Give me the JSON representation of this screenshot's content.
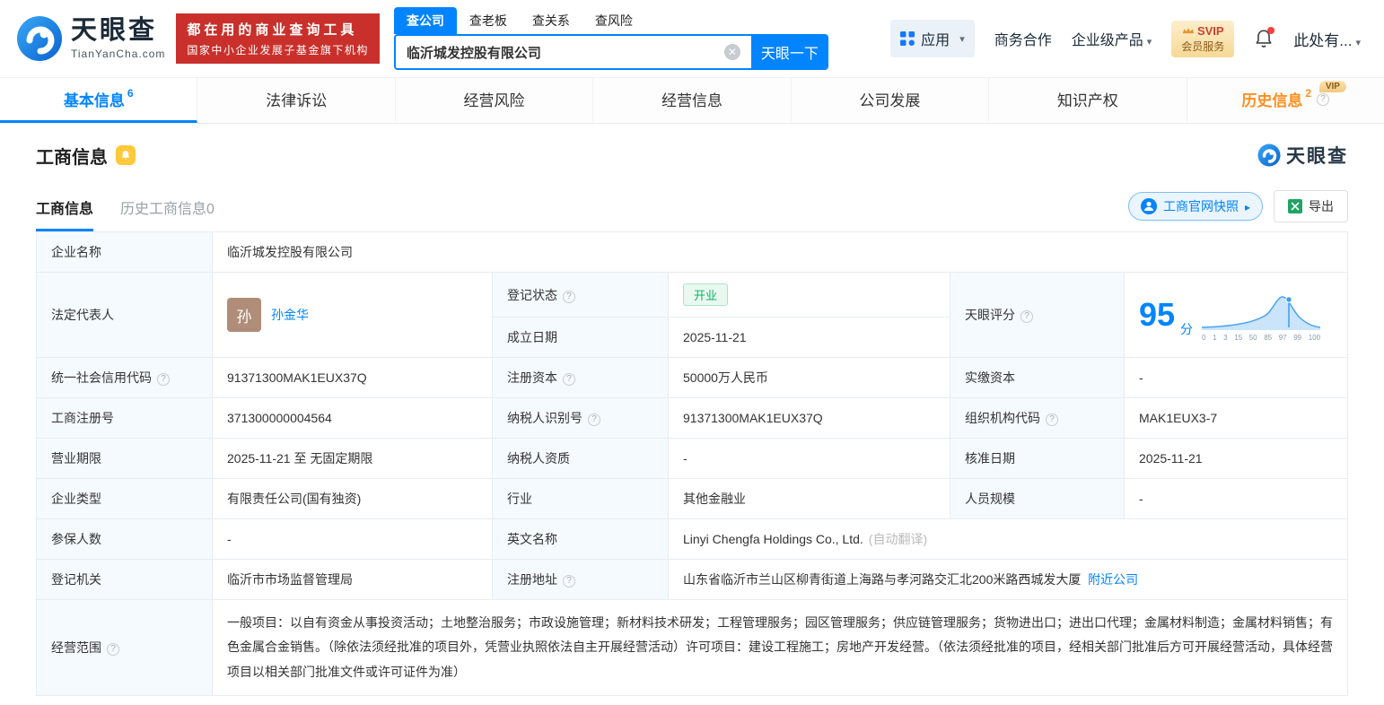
{
  "colors": {
    "accent": "#0084ff",
    "banner_red": "#c9302b",
    "vip_orange": "#ff8f1f",
    "status_green": "#10b267",
    "score_blue": "#0084ff"
  },
  "brand": {
    "name": "天眼查",
    "domain": "TianYanCha.com"
  },
  "banner": {
    "line1": "都在用的商业查询工具",
    "line2": "国家中小企业发展子基金旗下机构"
  },
  "search": {
    "tabs": [
      {
        "label": "查公司"
      },
      {
        "label": "查老板"
      },
      {
        "label": "查关系"
      },
      {
        "label": "查风险"
      }
    ],
    "value": "临沂城发控股有限公司",
    "button": "天眼一下"
  },
  "header_right": {
    "apps": "应用",
    "cooperation": "商务合作",
    "enterprise": "企业级产品",
    "svip_top": "SVIP",
    "svip_bottom": "会员服务",
    "account": "此处有..."
  },
  "nav": [
    {
      "label": "基本信息",
      "count": "6"
    },
    {
      "label": "法律诉讼"
    },
    {
      "label": "经营风险"
    },
    {
      "label": "经营信息"
    },
    {
      "label": "公司发展"
    },
    {
      "label": "知识产权"
    },
    {
      "label": "历史信息",
      "count": "2",
      "vip": "VIP"
    }
  ],
  "section": {
    "title": "工商信息",
    "subtab_active": "工商信息",
    "subtab_history": "历史工商信息0",
    "snapshot": "工商官网快照",
    "export": "导出",
    "watermark": "天眼查"
  },
  "fields": {
    "company_name": {
      "label": "企业名称",
      "value": "临沂城发控股有限公司"
    },
    "legal_rep": {
      "label": "法定代表人",
      "value": "孙金华",
      "avatar": "孙"
    },
    "reg_status": {
      "label": "登记状态",
      "value": "开业"
    },
    "establish_date": {
      "label": "成立日期",
      "value": "2025-11-21"
    },
    "score": {
      "label": "天眼评分",
      "value": "95",
      "unit": "分",
      "ticks": [
        "0",
        "1",
        "3",
        "15",
        "50",
        "85",
        "97",
        "99",
        "100"
      ]
    },
    "credit_code": {
      "label": "统一社会信用代码",
      "value": "91371300MAK1EUX37Q"
    },
    "reg_capital": {
      "label": "注册资本",
      "value": "50000万人民币"
    },
    "paid_capital": {
      "label": "实缴资本",
      "value": "-"
    },
    "reg_number": {
      "label": "工商注册号",
      "value": "371300000004564"
    },
    "taxpayer_id": {
      "label": "纳税人识别号",
      "value": "91371300MAK1EUX37Q"
    },
    "org_code": {
      "label": "组织机构代码",
      "value": "MAK1EUX3-7"
    },
    "business_term": {
      "label": "营业期限",
      "value": "2025-11-21 至 无固定期限"
    },
    "taxpayer_qualification": {
      "label": "纳税人资质",
      "value": "-"
    },
    "approval_date": {
      "label": "核准日期",
      "value": "2025-11-21"
    },
    "company_type": {
      "label": "企业类型",
      "value": "有限责任公司(国有独资)"
    },
    "industry": {
      "label": "行业",
      "value": "其他金融业"
    },
    "staff_size": {
      "label": "人员规模",
      "value": "-"
    },
    "insured_count": {
      "label": "参保人数",
      "value": "-"
    },
    "english_name": {
      "label": "英文名称",
      "value": "Linyi Chengfa Holdings Co., Ltd.",
      "note": "(自动翻译)"
    },
    "reg_authority": {
      "label": "登记机关",
      "value": "临沂市市场监督管理局"
    },
    "reg_address": {
      "label": "注册地址",
      "value": "山东省临沂市兰山区柳青街道上海路与孝河路交汇北200米路西城发大厦",
      "link": "附近公司"
    },
    "business_scope": {
      "label": "经营范围",
      "value": "一般项目：以自有资金从事投资活动；土地整治服务；市政设施管理；新材料技术研发；工程管理服务；园区管理服务；供应链管理服务；货物进出口；进出口代理；金属材料制造；金属材料销售；有色金属合金销售。（除依法须经批准的项目外，凭营业执照依法自主开展经营活动）许可项目：建设工程施工；房地产开发经营。（依法须经批准的项目，经相关部门批准后方可开展经营活动，具体经营项目以相关部门批准文件或许可证件为准）"
    }
  }
}
